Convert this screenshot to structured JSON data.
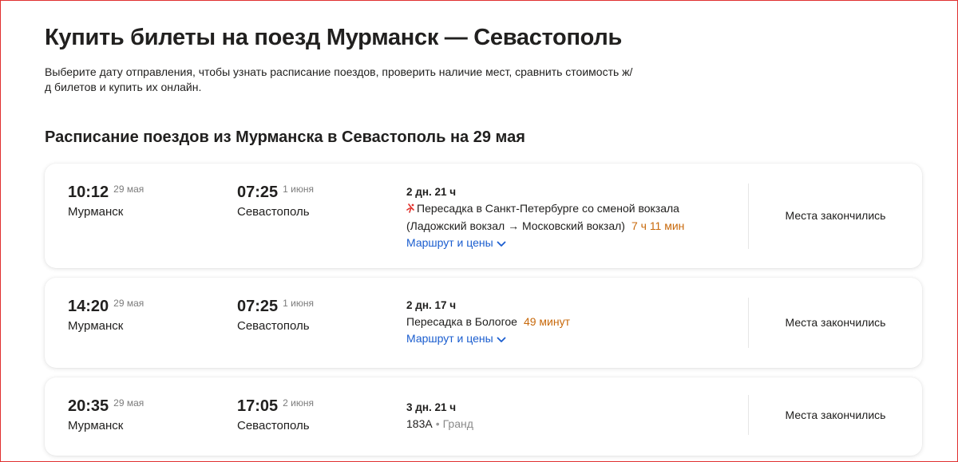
{
  "page": {
    "title": "Купить билеты на поезд Мурманск — Севастополь",
    "description": "Выберите дату отправления, чтобы узнать расписание поездов, проверить наличие мест, сравнить стоимость ж/д билетов и купить их онлайн.",
    "section_title": "Расписание поездов из Мурманска в Севастополь на 29 мая"
  },
  "trips": [
    {
      "departure": {
        "time": "10:12",
        "date": "29 мая",
        "city": "Мурманск"
      },
      "arrival": {
        "time": "07:25",
        "date": "1 июня",
        "city": "Севастополь"
      },
      "duration": "2 дн. 21 ч",
      "transfer_line1": "Пересадка в Санкт-Петербурге со сменой вокзала",
      "transfer_line2": "(Ладожский вокзал → Московский вокзал)",
      "transfer_time": "7 ч 11 мин",
      "route_link": "Маршрут и цены",
      "status": "Места закончились",
      "transfer_icon": "station-change-icon"
    },
    {
      "departure": {
        "time": "14:20",
        "date": "29 мая",
        "city": "Мурманск"
      },
      "arrival": {
        "time": "07:25",
        "date": "1 июня",
        "city": "Севастополь"
      },
      "duration": "2 дн. 17 ч",
      "transfer_line1": "Пересадка в Бологое",
      "transfer_time": "49 минут",
      "route_link": "Маршрут и цены",
      "status": "Места закончились"
    },
    {
      "departure": {
        "time": "20:35",
        "date": "29 мая",
        "city": "Мурманск"
      },
      "arrival": {
        "time": "17:05",
        "date": "2 июня",
        "city": "Севастополь"
      },
      "duration": "3 дн. 21 ч",
      "train_number": "183А",
      "train_separator": "•",
      "train_name": "Гранд",
      "status": "Места закончились"
    }
  ],
  "colors": {
    "accent_link": "#1a5dcf",
    "transfer_time": "#c8690b",
    "alert_icon": "#e0312b"
  }
}
